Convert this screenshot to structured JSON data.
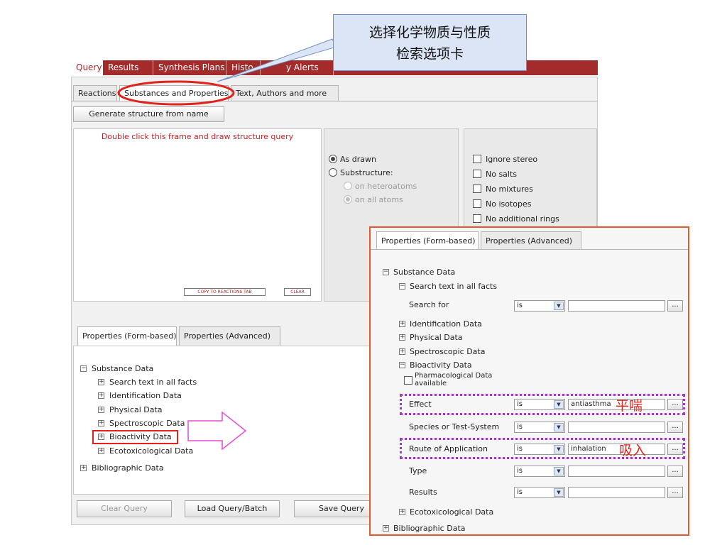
{
  "callout": {
    "line1": "选择化学物质与性质",
    "line2": "检索选项卡"
  },
  "top_nav": {
    "tabs": [
      "Query",
      "Results",
      "Synthesis Plans",
      "Histo",
      "y Alerts"
    ]
  },
  "sub_tabs": [
    "Reactions",
    "Substances and Properties",
    "Text, Authors and more"
  ],
  "generate_button": "Generate structure from name",
  "draw_area": {
    "hint": "Double click this frame and draw structure query",
    "copy_button": "COPY TO REACTIONS TAB",
    "clear_button": "CLEAR"
  },
  "match_options": {
    "as_drawn": "As drawn",
    "substructure": "Substructure:",
    "on_heteroatoms": "on heteroatoms",
    "on_all_atoms": "on all atoms"
  },
  "filters": [
    "Ignore stereo",
    "No salts",
    "No mixtures",
    "No isotopes",
    "No additional rings"
  ],
  "properties_tabs": [
    "Properties (Form-based)",
    "Properties (Advanced)"
  ],
  "left_tree": {
    "substance_data": "Substance Data",
    "items": [
      "Search text in all facts",
      "Identification Data",
      "Physical Data",
      "Spectroscopic Data",
      "Bioactivity Data",
      "Ecotoxicological Data"
    ],
    "bibliographic": "Bibliographic Data"
  },
  "bottom_buttons": {
    "clear": "Clear Query",
    "load": "Load Query/Batch",
    "save": "Save Query"
  },
  "overlay": {
    "tabs": [
      "Properties (Form-based)",
      "Properties (Advanced)"
    ],
    "substance_data": "Substance Data",
    "search_text": "Search text in all facts",
    "search_for": "Search for",
    "identification": "Identification Data",
    "physical": "Physical Data",
    "spectroscopic": "Spectroscopic Data",
    "bioactivity": "Bioactivity Data",
    "pharma_line1": "Pharmacological Data",
    "pharma_line2": "available",
    "fields": [
      {
        "label": "Effect",
        "op": "is",
        "value": "antiasthma",
        "note": "平喘"
      },
      {
        "label": "Species or Test-System",
        "op": "is",
        "value": "",
        "note": ""
      },
      {
        "label": "Route of Application",
        "op": "is",
        "value": "inhalation",
        "note": "吸入"
      },
      {
        "label": "Type",
        "op": "is",
        "value": "",
        "note": ""
      },
      {
        "label": "Results",
        "op": "is",
        "value": "",
        "note": ""
      }
    ],
    "search_for_op": "is",
    "ecotox": "Ecotoxicological Data",
    "bibliographic": "Bibliographic Data",
    "dots_label": "..."
  },
  "colors": {
    "nav_bar": "#a32b2b",
    "highlight_ellipse": "#e0241b",
    "overlay_border": "#e35a2e",
    "dashed_highlight": "#a334c9",
    "arrow": "#e94bd8",
    "callout_fill": "#dbe5f5"
  }
}
